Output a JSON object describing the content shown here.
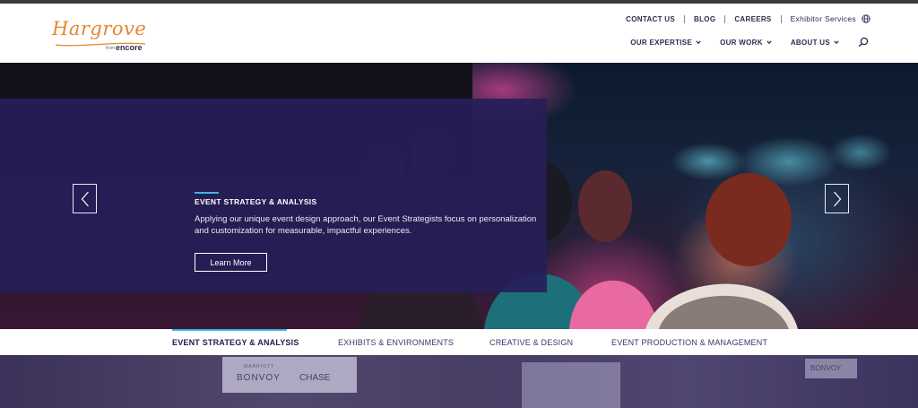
{
  "brand": {
    "name": "Hargrove",
    "from": "from",
    "parent": "encore",
    "accent": "#e8862b"
  },
  "utility_nav": [
    {
      "label": "CONTACT US"
    },
    {
      "label": "BLOG"
    },
    {
      "label": "CAREERS"
    },
    {
      "label": "Exhibitor Services"
    }
  ],
  "main_nav": [
    {
      "label": "OUR EXPERTISE"
    },
    {
      "label": "OUR WORK"
    },
    {
      "label": "ABOUT US"
    }
  ],
  "icons": {
    "globe": "globe-icon",
    "search": "search-icon",
    "prev": "chevron-left-icon",
    "next": "chevron-right-icon"
  },
  "hero": {
    "title": "EVENT STRATEGY & ANALYSIS",
    "description": "Applying our unique event design approach, our Event Strategists focus on personalization and customization for measurable, impactful experiences.",
    "cta": "Learn More",
    "panel_color": "#261e58",
    "accent_line": "#3fb6e3"
  },
  "tabs": [
    {
      "label": "EVENT STRATEGY & ANALYSIS",
      "active": true
    },
    {
      "label": "EXHIBITS & ENVIRONMENTS",
      "active": false
    },
    {
      "label": "CREATIVE & DESIGN",
      "active": false
    },
    {
      "label": "EVENT PRODUCTION & MANAGEMENT",
      "active": false
    }
  ],
  "bottom_image": {
    "booth_text_1": "BONVOY",
    "booth_text_2": "CHASE",
    "booth_text_3": "MARRIOTT",
    "booth_text_4": "BONVOY"
  }
}
